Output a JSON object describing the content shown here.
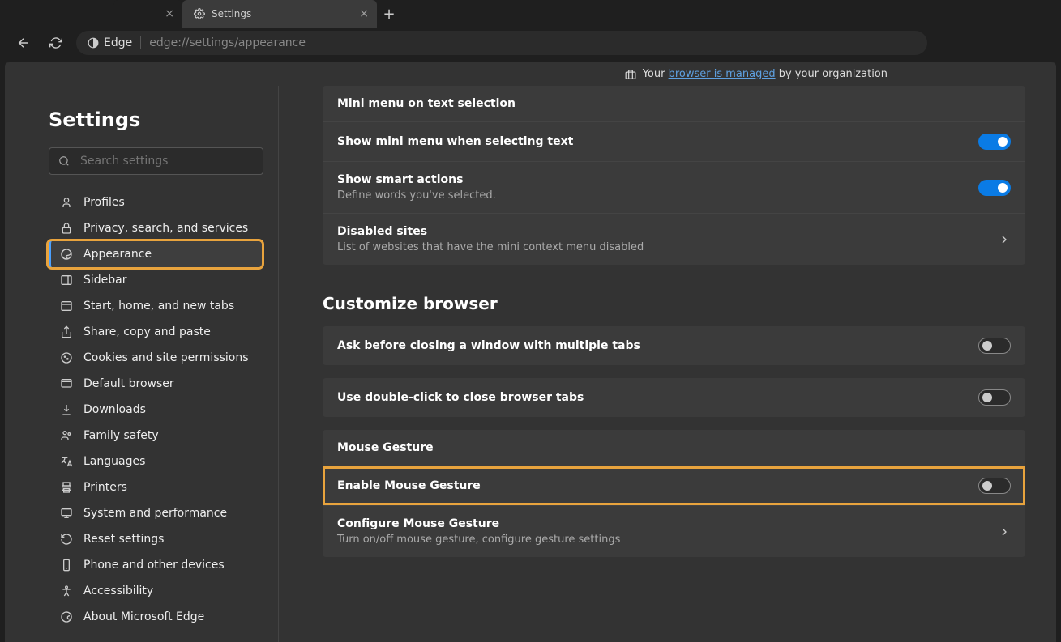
{
  "tabs": {
    "active_label": "Settings",
    "placeholder": ""
  },
  "addressbar": {
    "brand": "Edge",
    "url": "edge://settings/appearance"
  },
  "banner": {
    "prefix": "Your ",
    "link": "browser is managed",
    "suffix": " by your organization"
  },
  "sidebar": {
    "title": "Settings",
    "search_placeholder": "Search settings",
    "items": [
      {
        "label": "Profiles"
      },
      {
        "label": "Privacy, search, and services"
      },
      {
        "label": "Appearance"
      },
      {
        "label": "Sidebar"
      },
      {
        "label": "Start, home, and new tabs"
      },
      {
        "label": "Share, copy and paste"
      },
      {
        "label": "Cookies and site permissions"
      },
      {
        "label": "Default browser"
      },
      {
        "label": "Downloads"
      },
      {
        "label": "Family safety"
      },
      {
        "label": "Languages"
      },
      {
        "label": "Printers"
      },
      {
        "label": "System and performance"
      },
      {
        "label": "Reset settings"
      },
      {
        "label": "Phone and other devices"
      },
      {
        "label": "Accessibility"
      },
      {
        "label": "About Microsoft Edge"
      }
    ]
  },
  "content": {
    "mini_menu": {
      "header": "Mini menu on text selection",
      "show_mini": "Show mini menu when selecting text",
      "smart_actions": "Show smart actions",
      "smart_actions_sub": "Define words you've selected.",
      "disabled_sites": "Disabled sites",
      "disabled_sites_sub": "List of websites that have the mini context menu disabled"
    },
    "customize": {
      "title": "Customize browser",
      "ask_close": "Ask before closing a window with multiple tabs",
      "dbl_click": "Use double-click to close browser tabs",
      "mouse_gesture_hdr": "Mouse Gesture",
      "enable_mouse": "Enable Mouse Gesture",
      "configure_mouse": "Configure Mouse Gesture",
      "configure_mouse_sub": "Turn on/off mouse gesture, configure gesture settings"
    }
  }
}
